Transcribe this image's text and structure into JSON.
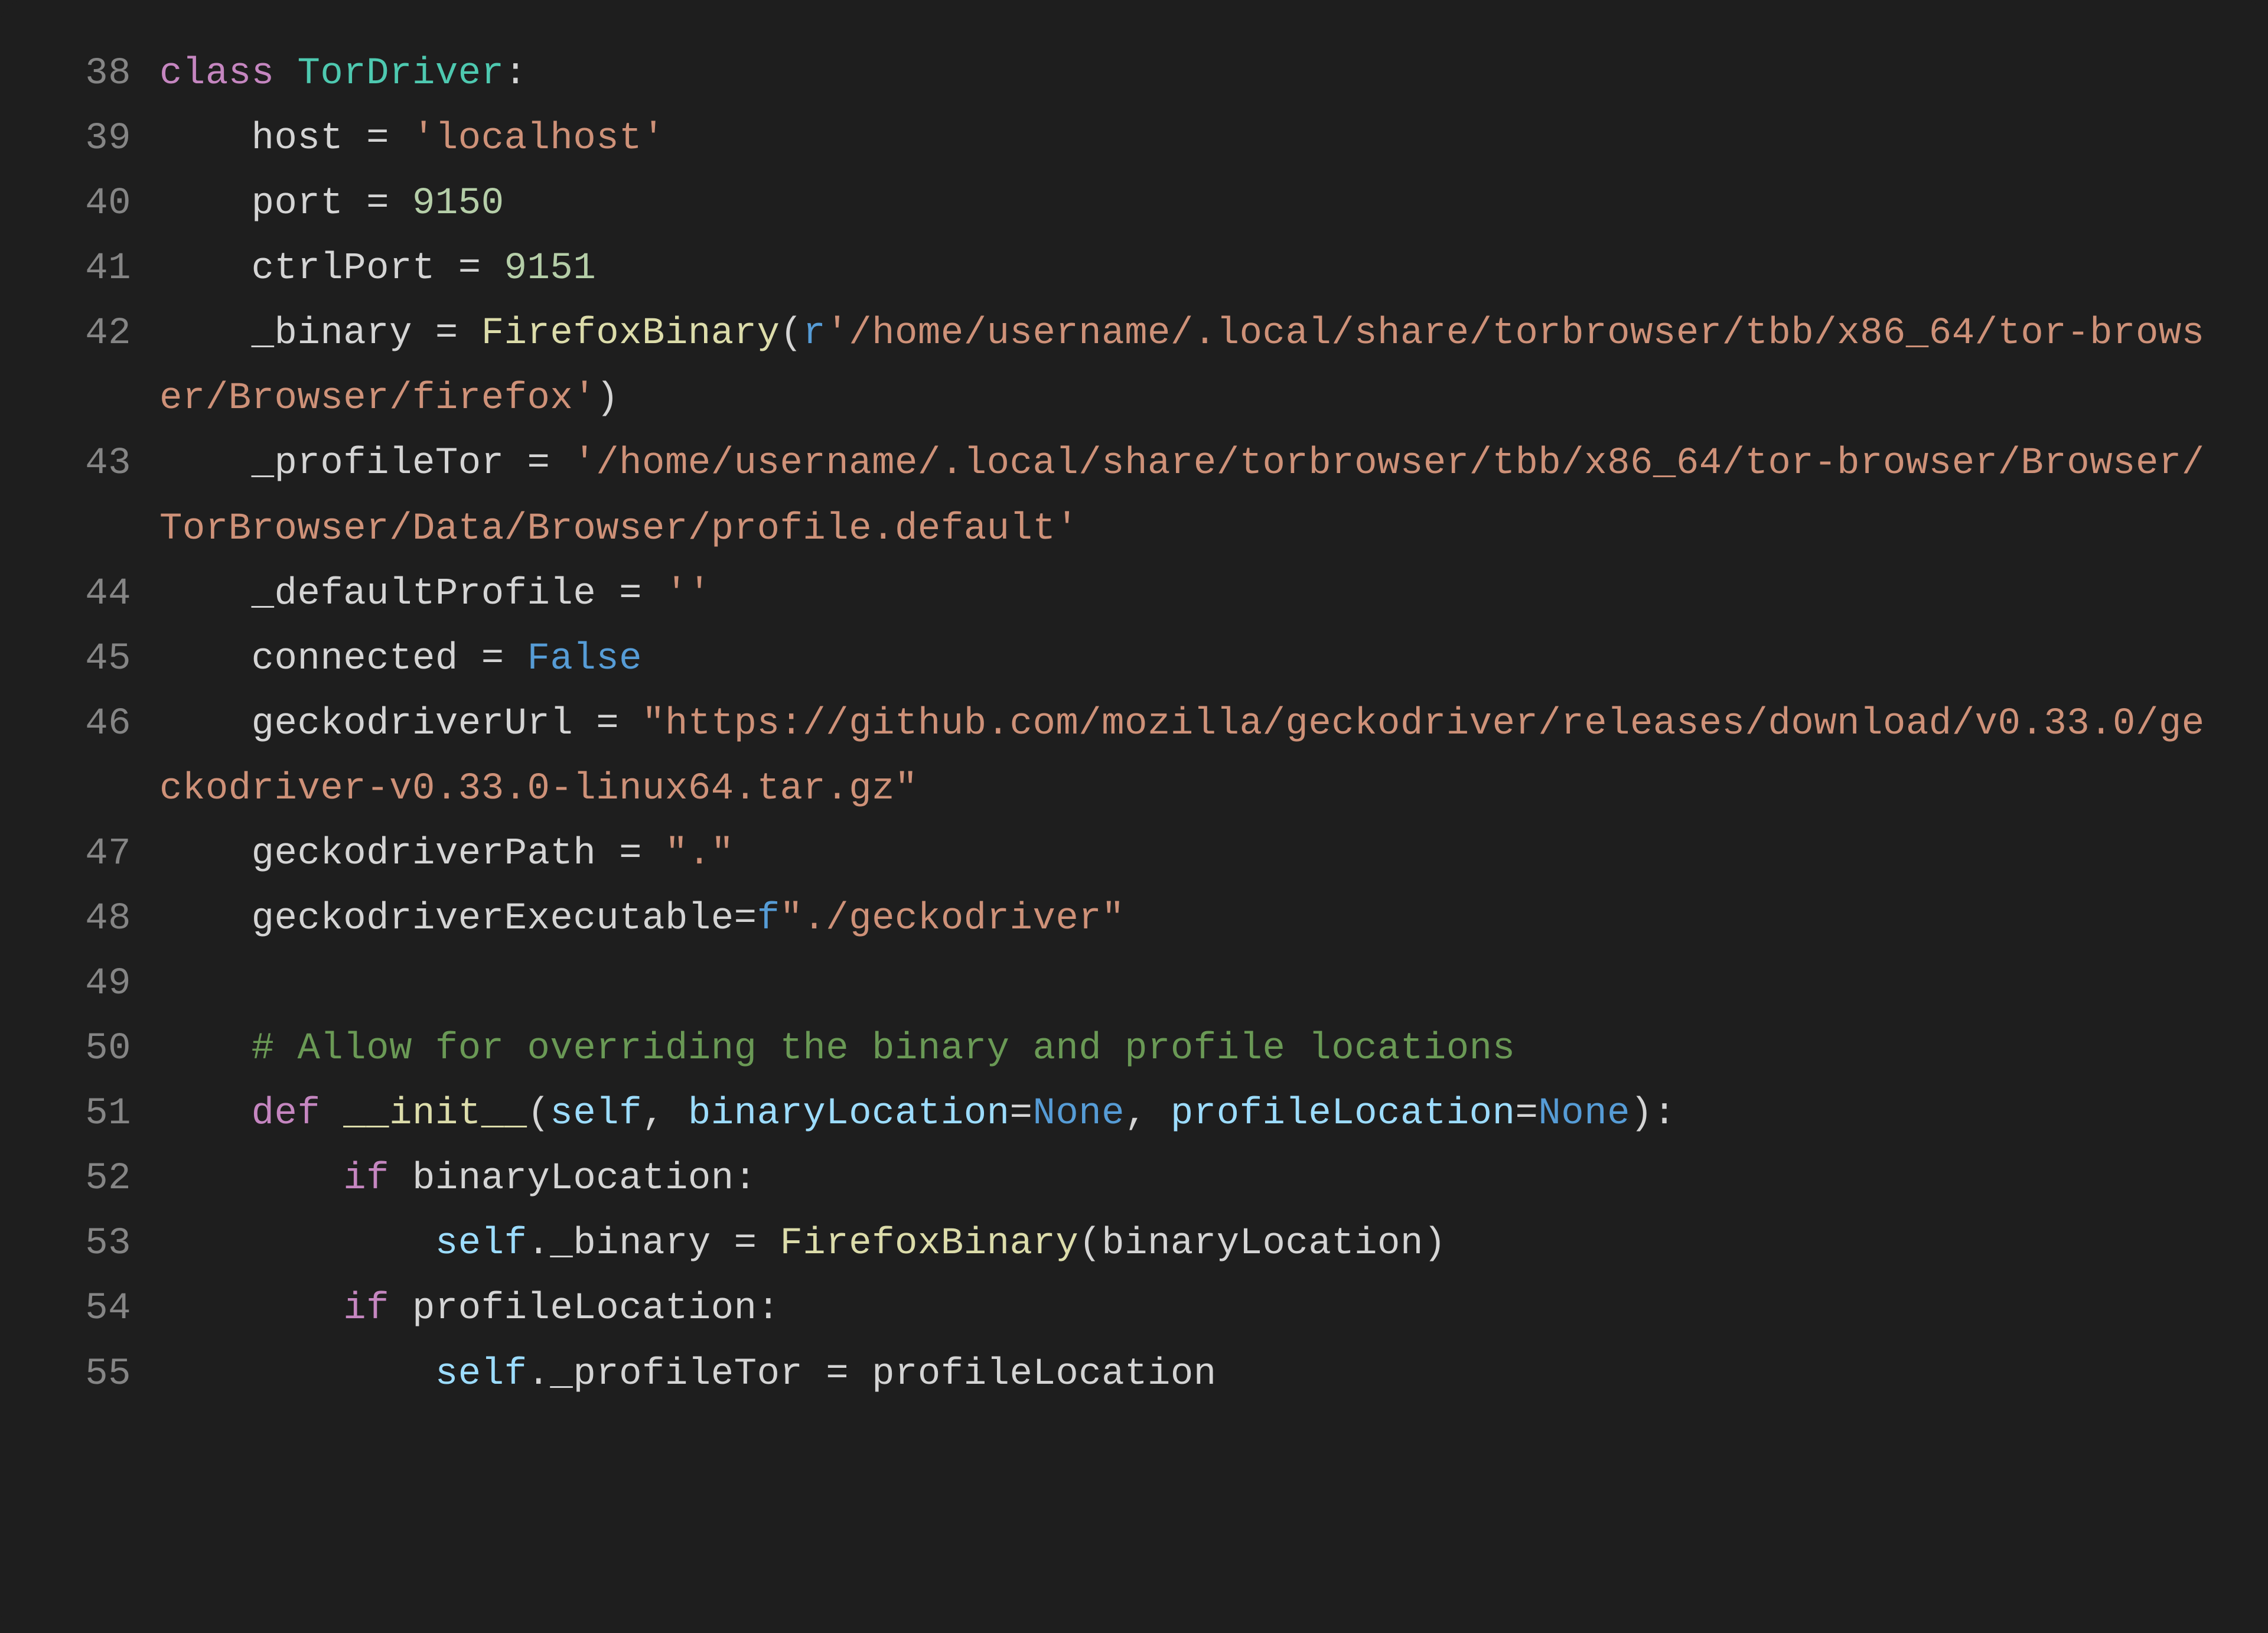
{
  "language": "python",
  "theme": "dark-plus",
  "lines": [
    {
      "num": "38",
      "indent": 0,
      "tokens": [
        [
          "kw",
          "class"
        ],
        [
          "sp",
          " "
        ],
        [
          "cls",
          "TorDriver"
        ],
        [
          "pn",
          ":"
        ]
      ]
    },
    {
      "num": "39",
      "indent": 1,
      "tokens": [
        [
          "id",
          "host"
        ],
        [
          "sp",
          " "
        ],
        [
          "op",
          "="
        ],
        [
          "sp",
          " "
        ],
        [
          "str",
          "'localhost'"
        ]
      ]
    },
    {
      "num": "40",
      "indent": 1,
      "tokens": [
        [
          "id",
          "port"
        ],
        [
          "sp",
          " "
        ],
        [
          "op",
          "="
        ],
        [
          "sp",
          " "
        ],
        [
          "num",
          "9150"
        ]
      ]
    },
    {
      "num": "41",
      "indent": 1,
      "tokens": [
        [
          "id",
          "ctrlPort"
        ],
        [
          "sp",
          " "
        ],
        [
          "op",
          "="
        ],
        [
          "sp",
          " "
        ],
        [
          "num",
          "9151"
        ]
      ]
    },
    {
      "num": "42",
      "indent": 1,
      "tokens": [
        [
          "id",
          "_binary"
        ],
        [
          "sp",
          " "
        ],
        [
          "op",
          "="
        ],
        [
          "sp",
          " "
        ],
        [
          "fn",
          "FirefoxBinary"
        ],
        [
          "pn",
          "("
        ],
        [
          "cst",
          "r"
        ],
        [
          "str",
          "'/home/username/.local/share/torbrowser/tbb/x86_64/tor-browser/Browser/firefox'"
        ],
        [
          "pn",
          ")"
        ]
      ]
    },
    {
      "num": "43",
      "indent": 1,
      "tokens": [
        [
          "id",
          "_profileTor"
        ],
        [
          "sp",
          " "
        ],
        [
          "op",
          "="
        ],
        [
          "sp",
          " "
        ],
        [
          "str",
          "'/home/username/.local/share/torbrowser/tbb/x86_64/tor-browser/Browser/TorBrowser/Data/Browser/profile.default'"
        ]
      ]
    },
    {
      "num": "44",
      "indent": 1,
      "tokens": [
        [
          "id",
          "_defaultProfile"
        ],
        [
          "sp",
          " "
        ],
        [
          "op",
          "="
        ],
        [
          "sp",
          " "
        ],
        [
          "str",
          "''"
        ]
      ]
    },
    {
      "num": "45",
      "indent": 1,
      "tokens": [
        [
          "id",
          "connected"
        ],
        [
          "sp",
          " "
        ],
        [
          "op",
          "="
        ],
        [
          "sp",
          " "
        ],
        [
          "cst",
          "False"
        ]
      ]
    },
    {
      "num": "46",
      "indent": 1,
      "tokens": [
        [
          "id",
          "geckodriverUrl"
        ],
        [
          "sp",
          " "
        ],
        [
          "op",
          "="
        ],
        [
          "sp",
          " "
        ],
        [
          "str",
          "\"https://github.com/mozilla/geckodriver/releases/download/v0.33.0/geckodriver-v0.33.0-linux64.tar.gz\""
        ]
      ]
    },
    {
      "num": "47",
      "indent": 1,
      "tokens": [
        [
          "id",
          "geckodriverPath"
        ],
        [
          "sp",
          " "
        ],
        [
          "op",
          "="
        ],
        [
          "sp",
          " "
        ],
        [
          "str",
          "\".\""
        ]
      ]
    },
    {
      "num": "48",
      "indent": 1,
      "tokens": [
        [
          "id",
          "geckodriverExecutable"
        ],
        [
          "op",
          "="
        ],
        [
          "cst",
          "f"
        ],
        [
          "str",
          "\"./geckodriver\""
        ]
      ]
    },
    {
      "num": "49",
      "indent": 0,
      "tokens": []
    },
    {
      "num": "50",
      "indent": 1,
      "tokens": [
        [
          "cmt",
          "# Allow for overriding the binary and profile locations"
        ]
      ]
    },
    {
      "num": "51",
      "indent": 1,
      "tokens": [
        [
          "kw",
          "def"
        ],
        [
          "sp",
          " "
        ],
        [
          "fn",
          "__init__"
        ],
        [
          "pn",
          "("
        ],
        [
          "self",
          "self"
        ],
        [
          "pn",
          ","
        ],
        [
          "sp",
          " "
        ],
        [
          "prm",
          "binaryLocation"
        ],
        [
          "op",
          "="
        ],
        [
          "cst",
          "None"
        ],
        [
          "pn",
          ","
        ],
        [
          "sp",
          " "
        ],
        [
          "prm",
          "profileLocation"
        ],
        [
          "op",
          "="
        ],
        [
          "cst",
          "None"
        ],
        [
          "pn",
          ")"
        ],
        [
          "pn",
          ":"
        ]
      ]
    },
    {
      "num": "52",
      "indent": 2,
      "tokens": [
        [
          "kw",
          "if"
        ],
        [
          "sp",
          " "
        ],
        [
          "id",
          "binaryLocation"
        ],
        [
          "pn",
          ":"
        ]
      ]
    },
    {
      "num": "53",
      "indent": 3,
      "tokens": [
        [
          "self",
          "self"
        ],
        [
          "pn",
          "."
        ],
        [
          "id",
          "_binary"
        ],
        [
          "sp",
          " "
        ],
        [
          "op",
          "="
        ],
        [
          "sp",
          " "
        ],
        [
          "fn",
          "FirefoxBinary"
        ],
        [
          "pn",
          "("
        ],
        [
          "id",
          "binaryLocation"
        ],
        [
          "pn",
          ")"
        ]
      ]
    },
    {
      "num": "54",
      "indent": 2,
      "tokens": [
        [
          "kw",
          "if"
        ],
        [
          "sp",
          " "
        ],
        [
          "id",
          "profileLocation"
        ],
        [
          "pn",
          ":"
        ]
      ]
    },
    {
      "num": "55",
      "indent": 3,
      "tokens": [
        [
          "self",
          "self"
        ],
        [
          "pn",
          "."
        ],
        [
          "id",
          "_profileTor"
        ],
        [
          "sp",
          " "
        ],
        [
          "op",
          "="
        ],
        [
          "sp",
          " "
        ],
        [
          "id",
          "profileLocation"
        ]
      ]
    }
  ],
  "indent_unit": "    "
}
